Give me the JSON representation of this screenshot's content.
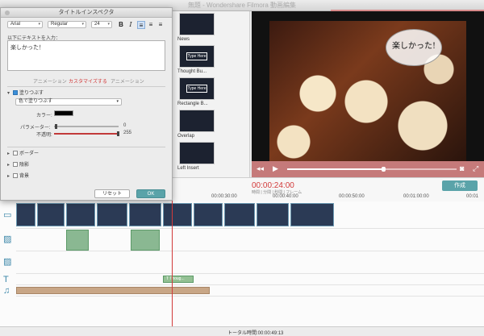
{
  "app": {
    "window_title": "無題 - Wondershare Filmora 動画編集"
  },
  "inspector": {
    "title": "タイトルインスペクタ",
    "font": "Arial",
    "style": "Regular",
    "size": "24",
    "bold_label": "B",
    "italic_label": "I",
    "prompt": "以下にテキストを入力：",
    "text_value": "楽しかった！",
    "tabs": [
      "アニメーション",
      "カスタマイズする",
      "アニメーション"
    ],
    "fill_label": "塗りつぶす",
    "fill_mode": "色で塗りつぶす",
    "color_label": "カラー:",
    "parameter_label": "パラメーター:",
    "parameter_value": "0",
    "opacity_label": "不透明:",
    "opacity_value": "255",
    "border_label": "ボーダー",
    "shadow_label": "陰影",
    "background_label": "背景",
    "reset_label": "リセット",
    "ok_label": "OK"
  },
  "media_library": {
    "items": [
      {
        "label": "News",
        "thumb_text": ""
      },
      {
        "label": "Thought Bu...",
        "thumb_text": "Type Here"
      },
      {
        "label": "Rectangle B...",
        "thumb_text": "Type Here"
      },
      {
        "label": "Overlap",
        "thumb_text": ""
      },
      {
        "label": "Left Insert",
        "thumb_text": ""
      }
    ]
  },
  "preview": {
    "overlay_text": "楽しかった!"
  },
  "timeline": {
    "current_time": "00:00:24:00",
    "time_format": "時間 | 分間 | 秒間 | フレーム",
    "export_label": "作成",
    "ruler": [
      "00:00:30:00",
      "00:00:40:00",
      "00:00:50:00",
      "00:01:00:00",
      "00:01"
    ],
    "text_clip_label": "T Thoug...",
    "total_time": "トータル時間:00:00:49:13"
  },
  "colors": {
    "accent": "#5aa3a9",
    "playhead": "#d23a3a",
    "preview_controls": "#c57a7a"
  }
}
